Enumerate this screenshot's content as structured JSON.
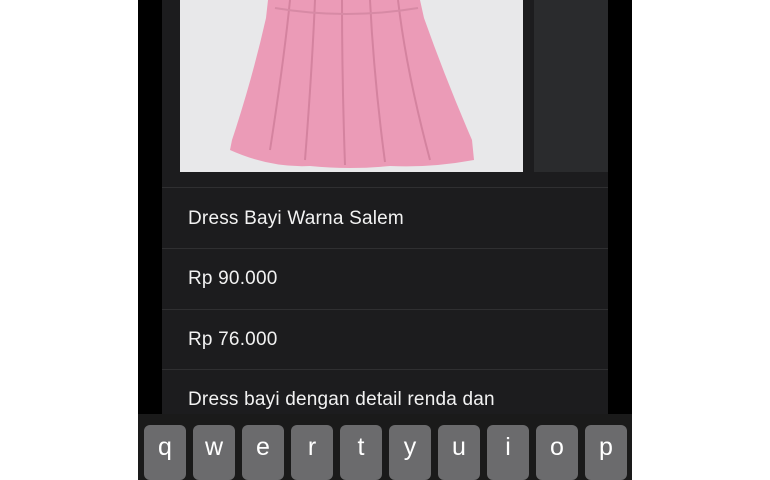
{
  "product": {
    "name": "Dress Bayi Warna Salem",
    "price": "Rp 90.000",
    "sale_price": "Rp 76.000",
    "description": "Dress bayi dengan detail renda dan"
  },
  "keyboard": {
    "keys": [
      "q",
      "w",
      "e",
      "r",
      "t",
      "y",
      "u",
      "i",
      "o",
      "p"
    ]
  },
  "colors": {
    "sheet_background": "#1c1c1e",
    "key_background": "#6b6b6d",
    "dress_pink": "#eb9bb7"
  }
}
